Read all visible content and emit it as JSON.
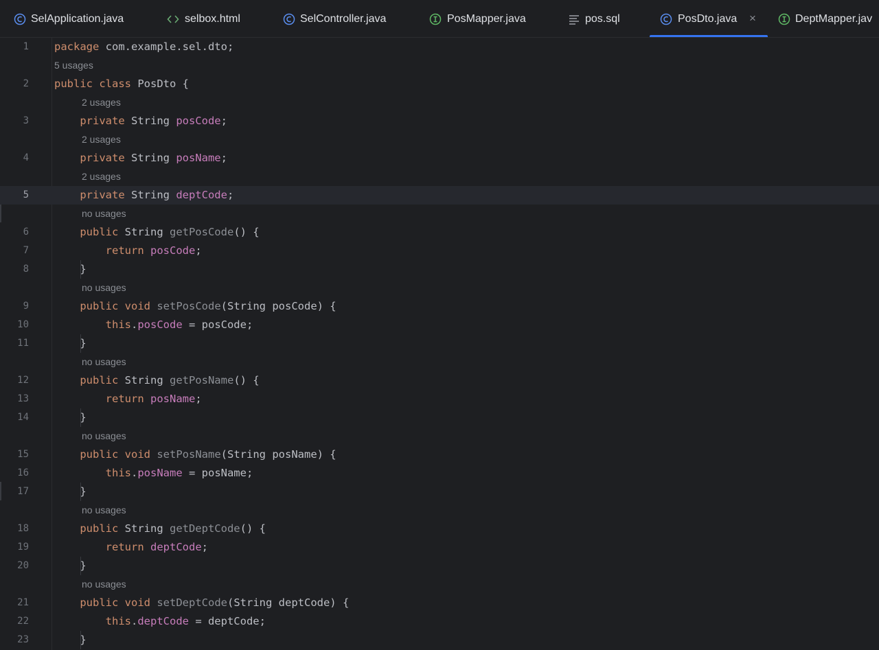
{
  "tabs": [
    {
      "label": "SelApplication.java",
      "icon": "class-icon"
    },
    {
      "label": "selbox.html",
      "icon": "html-icon"
    },
    {
      "label": "SelController.java",
      "icon": "class-icon"
    },
    {
      "label": "PosMapper.java",
      "icon": "interface-icon"
    },
    {
      "label": "pos.sql",
      "icon": "sql-file-icon"
    },
    {
      "label": "PosDto.java",
      "icon": "class-icon",
      "active": true,
      "close": "×"
    },
    {
      "label": "DeptMapper.jav",
      "icon": "interface-icon"
    }
  ],
  "colors": {
    "accent": "#3574f0",
    "keyword": "#cf8e6d",
    "field": "#c77dbb",
    "class_icon": "#5a8ef0",
    "interface_icon": "#5fb865",
    "html_icon": "#6aab73"
  },
  "hints": {
    "h1": "5 usages",
    "h2": "2 usages",
    "h3": "2 usages",
    "h4": "2 usages",
    "h5": "no usages",
    "h6": "no usages",
    "h7": "no usages",
    "h8": "no usages",
    "h9": "no usages",
    "h10": "no usages"
  },
  "lines": {
    "n1": "1",
    "n2": "2",
    "n3": "3",
    "n4": "4",
    "n5": "5",
    "n6": "6",
    "n7": "7",
    "n8": "8",
    "n9": "9",
    "n10": "10",
    "n11": "11",
    "n12": "12",
    "n13": "13",
    "n14": "14",
    "n15": "15",
    "n16": "16",
    "n17": "17",
    "n18": "18",
    "n19": "19",
    "n20": "20",
    "n21": "21",
    "n22": "22",
    "n23": "23"
  },
  "code": {
    "l1": {
      "kw": "package",
      "rest": " com.example.sel.dto;"
    },
    "l2": {
      "kw1": "public",
      "kw2": "class",
      "rest": " PosDto {"
    },
    "l3": {
      "kw": "private",
      "type": " String ",
      "field": "posCode",
      "end": ";"
    },
    "l4": {
      "kw": "private",
      "type": " String ",
      "field": "posName",
      "end": ";"
    },
    "l5": {
      "kw": "private",
      "type": " String ",
      "field": "deptCode",
      "end": ";"
    },
    "l6": {
      "kw": "public",
      "type": " String ",
      "method": "getPosCode",
      "end": "() {"
    },
    "l7": {
      "kw": "return",
      "field": "posCode",
      "end": ";"
    },
    "l8": {
      "text": "}"
    },
    "l9": {
      "kw1": "public",
      "kw2": "void",
      "method": "setPosCode",
      "end": "(String posCode) {"
    },
    "l10": {
      "kw": "this",
      "dot": ".",
      "field": "posCode",
      "end": " = posCode;"
    },
    "l11": {
      "text": "}"
    },
    "l12": {
      "kw": "public",
      "type": " String ",
      "method": "getPosName",
      "end": "() {"
    },
    "l13": {
      "kw": "return",
      "field": "posName",
      "end": ";"
    },
    "l14": {
      "text": "}"
    },
    "l15": {
      "kw1": "public",
      "kw2": "void",
      "method": "setPosName",
      "end": "(String posName) {"
    },
    "l16": {
      "kw": "this",
      "dot": ".",
      "field": "posName",
      "end": " = posName;"
    },
    "l17": {
      "text": "}"
    },
    "l18": {
      "kw": "public",
      "type": " String ",
      "method": "getDeptCode",
      "end": "() {"
    },
    "l19": {
      "kw": "return",
      "field": "deptCode",
      "end": ";"
    },
    "l20": {
      "text": "}"
    },
    "l21": {
      "kw1": "public",
      "kw2": "void",
      "method": "setDeptCode",
      "end": "(String deptCode) {"
    },
    "l22": {
      "kw": "this",
      "dot": ".",
      "field": "deptCode",
      "end": " = deptCode;"
    },
    "l23": {
      "text": "}"
    }
  }
}
